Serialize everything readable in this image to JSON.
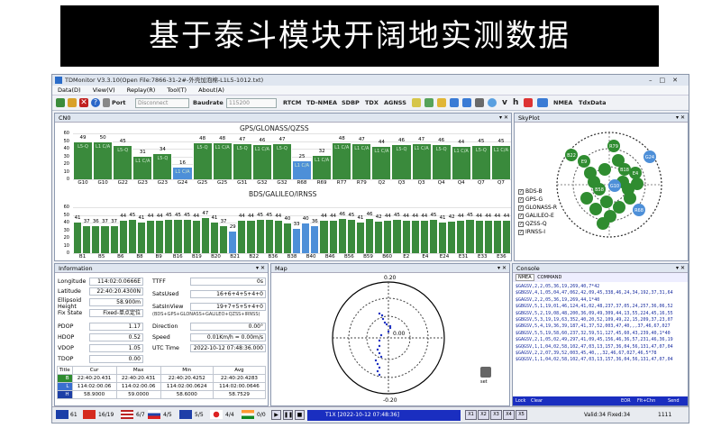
{
  "banner": "基于泰斗模块开阔地实测数据",
  "app": {
    "title": "TDMonitor V3.3.10(Open File:7866-31-2#-外壳加泡棉-L1L5-1012.txt)",
    "menu": [
      "Data(D)",
      "View(V)",
      "Replay(R)",
      "Tool(T)",
      "About(A)"
    ],
    "toolbar": {
      "port_label": "Port",
      "port_value": "Disconnect",
      "baud_label": "Baudrate",
      "baud_value": "115200",
      "buttons": [
        "RTCM",
        "TD-NMEA",
        "SDBP",
        "TDX",
        "AGNSS"
      ],
      "right_labels": [
        "NMEA",
        "TdxData"
      ]
    }
  },
  "cn0": {
    "tab": "CN0",
    "yticks": [
      "60",
      "50",
      "40",
      "30",
      "20",
      "10",
      "0"
    ],
    "chart1": {
      "title": "GPS/GLONASS/QZSS",
      "bars": [
        {
          "name": "G10",
          "val": "49",
          "lbl": "L5-Q",
          "c": "g",
          "v": 49
        },
        {
          "name": "G10",
          "val": "50",
          "lbl": "L1 C/A",
          "c": "g",
          "v": 50
        },
        {
          "name": "G22",
          "val": "45",
          "lbl": "L5-Q",
          "c": "g",
          "v": 45
        },
        {
          "name": "G23",
          "val": "31",
          "lbl": "L1 C/A",
          "c": "g",
          "v": 31
        },
        {
          "name": "G23",
          "val": "34",
          "lbl": "L5-Q",
          "c": "g",
          "v": 34
        },
        {
          "name": "G24",
          "val": "16",
          "lbl": "L1 C/A",
          "c": "b",
          "v": 16
        },
        {
          "name": "G25",
          "val": "48",
          "lbl": "L5-Q",
          "c": "g",
          "v": 48
        },
        {
          "name": "G25",
          "val": "48",
          "lbl": "L1 C/A",
          "c": "g",
          "v": 48
        },
        {
          "name": "G31",
          "val": "47",
          "lbl": "L5-Q",
          "c": "g",
          "v": 47
        },
        {
          "name": "G32",
          "val": "46",
          "lbl": "L1 C/A",
          "c": "g",
          "v": 46
        },
        {
          "name": "G32",
          "val": "47",
          "lbl": "L5-Q",
          "c": "g",
          "v": 47
        },
        {
          "name": "R68",
          "val": "25",
          "lbl": "L1 C/A",
          "c": "b",
          "v": 25
        },
        {
          "name": "R69",
          "val": "32",
          "lbl": "L1 C/A",
          "c": "g",
          "v": 32
        },
        {
          "name": "R77",
          "val": "48",
          "lbl": "L1 C/A",
          "c": "g",
          "v": 48
        },
        {
          "name": "R79",
          "val": "47",
          "lbl": "L1 C/A",
          "c": "g",
          "v": 47
        },
        {
          "name": "Q2",
          "val": "44",
          "lbl": "L1 C/A",
          "c": "g",
          "v": 44
        },
        {
          "name": "Q3",
          "val": "46",
          "lbl": "L5-Q",
          "c": "g",
          "v": 46
        },
        {
          "name": "Q3",
          "val": "47",
          "lbl": "L1 C/A",
          "c": "g",
          "v": 47
        },
        {
          "name": "Q4",
          "val": "46",
          "lbl": "L5-Q",
          "c": "g",
          "v": 46
        },
        {
          "name": "Q4",
          "val": "44",
          "lbl": "L1 C/A",
          "c": "g",
          "v": 44
        },
        {
          "name": "Q7",
          "val": "45",
          "lbl": "L5-Q",
          "c": "g",
          "v": 45
        },
        {
          "name": "Q7",
          "val": "45",
          "lbl": "L1 C/A",
          "c": "g",
          "v": 45
        }
      ],
      "xticks": [
        "G10",
        "G10",
        "G22",
        "G23",
        "G23",
        "G24",
        "G25",
        "G25",
        "G31",
        "G32",
        "G32",
        "R68",
        "R69",
        "R77",
        "R79",
        "Q2",
        "Q3",
        "Q3",
        "Q4",
        "Q4",
        "Q7",
        "Q7"
      ]
    },
    "chart2": {
      "title": "BDS/GALILEO/IRNSS",
      "vals": [
        41,
        37,
        36,
        37,
        37,
        44,
        45,
        41,
        44,
        44,
        45,
        45,
        45,
        44,
        47,
        41,
        37,
        29,
        44,
        44,
        45,
        45,
        44,
        40,
        33,
        40,
        36,
        44,
        44,
        46,
        45,
        41,
        46,
        42,
        44,
        45,
        44,
        44,
        44,
        45,
        41,
        42,
        44,
        45,
        44,
        44,
        44,
        44
      ],
      "blue": [
        17,
        24,
        25,
        26
      ],
      "vals_text": [
        "41",
        "37",
        "36",
        "37",
        "37",
        "44",
        "45",
        "41",
        "44",
        "44",
        "45",
        "45",
        "45",
        "44",
        "47",
        "41",
        "37",
        "29",
        "44",
        "44",
        "45",
        "45",
        "44",
        "40",
        "33",
        "40",
        "36",
        "44",
        "44",
        "46",
        "45",
        "41",
        "46",
        "42",
        "44",
        "45",
        "44",
        "44",
        "44",
        "45",
        "41",
        "42",
        "44",
        "45",
        "44",
        "44",
        "44",
        "44"
      ],
      "xticks": [
        "B1",
        "B5",
        "B6",
        "B8",
        "B9",
        "B16",
        "B19",
        "B20",
        "B21",
        "B22",
        "B36",
        "B38",
        "B40",
        "B46",
        "B56",
        "B59",
        "B60",
        "E2",
        "E4",
        "E24",
        "E31",
        "E33",
        "E36"
      ]
    }
  },
  "sky": {
    "tab": "SkyPlot",
    "legend": [
      "BDS-B",
      "GPS-G",
      "GLONASS-R",
      "GALILEO-E",
      "QZSS-Q",
      "IRNSS-I"
    ],
    "sats": [
      "B22",
      "E9",
      "R79",
      "G24",
      "E4",
      "B18",
      "R68",
      "G10",
      "B58"
    ]
  },
  "info": {
    "tab": "Information",
    "longitude_label": "Longitude",
    "longitude": "114:02:0.0666E",
    "latitude_label": "Latitude",
    "latitude": "22:40:20.4300N",
    "height_label": "Ellipsoid Height",
    "height": "58.900m",
    "fix_label": "Fix State",
    "fix": "Fixed-单点定位",
    "pdop_label": "PDOP",
    "pdop": "1.17",
    "hdop_label": "HDOP",
    "hdop": "0.52",
    "vdop_label": "VDOP",
    "vdop": "1.05",
    "tdop_label": "TDOP",
    "tdop": "0.00",
    "ttff_label": "TTFF",
    "ttff": "0s",
    "satsused_label": "SatsUsed",
    "satsused": "16+6+4+5+4+0",
    "satsinview_label": "SatsInView",
    "satsinview": "19+7+5+5+4+0",
    "satsinview_desc": "(BDS+GPS+GLONASS+GALILEO+QZSS+IRNSS)",
    "dir_label": "Direction",
    "dir": "0.00°",
    "speed_label": "Speed",
    "speed": "0.01Km/h = 0.00m/s",
    "utc_label": "UTC Time",
    "utc": "2022-10-12 07:48:36.000",
    "table": {
      "headers": [
        "Title",
        "Cur",
        "Max",
        "Min",
        "Avg"
      ],
      "rows": [
        {
          "name": "B",
          "cur": "22:40:20.431",
          "max": "22:40:20.431",
          "min": "22:40:20.4252",
          "avg": "22:40:20.4283"
        },
        {
          "name": "L",
          "cur": "114:02:00.06",
          "max": "114:02:00.06",
          "min": "114:02:00.0624",
          "avg": "114:02:00.0646"
        },
        {
          "name": "H",
          "cur": "58.9000",
          "max": "59.0000",
          "min": "58.6000",
          "avg": "58.7529"
        }
      ]
    }
  },
  "map": {
    "tab": "Map",
    "scale_top": "0.20",
    "scale_left": "-0.20",
    "scale_center": "0.00",
    "scale_right": "0.20",
    "scale_bottom": "-0.20",
    "set_label": "set"
  },
  "console": {
    "tab": "Console",
    "subtabs": [
      "NMEA",
      "COMMAND"
    ],
    "lines": [
      "$GAGSV,2,2,05,36,19,269,40,7*42",
      "$GBGSV,4,1,05,04,47,062,42,09,45,338,46,24,34,192,37,31,64",
      "$GAGSV,2,2,05,36,19,269,44,1*40",
      "$GBGSV,5,1,19,01,46,124,41,02,48,237,37,05,24,257,36,06,52",
      "$GBGSV,5,2,19,08,48,200,36,09,49,309,44,13,55,224,45,16,55",
      "$GBGSV,5,3,19,19,63,352,40,20,52,109,49,22,15,209,37,23,07",
      "$GBGSV,5,4,19,36,39,187,41,37,52,003,47,40,,,37,46,67,027",
      "$GBGSV,5,5,19,58,60,237,32,59,51,127,45,60,43,239,40,1*40",
      "$GAGSV,2,1,05,02,49,297,41,09,45,156,46,36,57,231,46,36,19",
      "$GQGSV,1,1,04,02,58,102,47,03,13,157,36,04,56,131,47,07,04",
      "$GAGSV,2,2,07,39,52,003,45,40,,,32,46,67,027,46,5*78",
      "$GQGSV,1,1,04,02,58,102,47,03,13,157,36,04,56,131,47,07,04"
    ],
    "bottom": [
      "Lock",
      "Clear",
      "EOR",
      "Flt+Chn",
      "Send"
    ]
  },
  "status": {
    "items": [
      "61",
      "16/19",
      "6/7",
      "4/5",
      "5/5",
      "4/4",
      "0/0"
    ],
    "play_info": "T1X [2022-10-12 07:48:36]",
    "x_buttons": [
      "X1",
      "X2",
      "X3",
      "X4",
      "X5"
    ],
    "valid": "Valid:34 Fixed:34",
    "counter": "1111"
  }
}
